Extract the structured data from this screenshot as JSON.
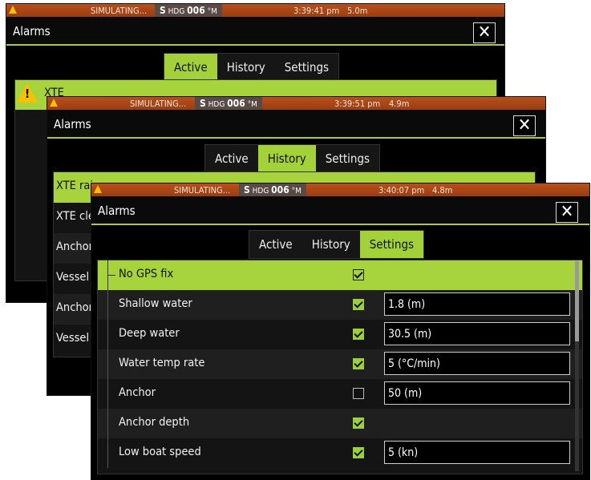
{
  "back_panel": {
    "status": {
      "sim": "SIMULATING...",
      "hdg_s": "S",
      "hdg_label": "HDG",
      "hdg_value": "006",
      "hdg_unit": "°M",
      "time": "3:39:41 pm",
      "depth": "5.0m"
    },
    "title": "Alarms",
    "close": "✕",
    "tabs": [
      {
        "label": "Active",
        "active": true
      },
      {
        "label": "History",
        "active": false
      },
      {
        "label": "Settings",
        "active": false
      }
    ],
    "active_alarm": "XTE"
  },
  "middle_panel": {
    "status": {
      "sim": "SIMULATING...",
      "hdg_s": "S",
      "hdg_label": "HDG",
      "hdg_value": "006",
      "hdg_unit": "°M",
      "time": "3:39:51 pm",
      "depth": "4.9m"
    },
    "title": "Alarms",
    "close": "✕",
    "tabs": [
      {
        "label": "Active",
        "active": false
      },
      {
        "label": "History",
        "active": true
      },
      {
        "label": "Settings",
        "active": false
      }
    ],
    "history": [
      "XTE rai",
      "XTE cle",
      "Anchor",
      "Vessel",
      "Anchor",
      "Vessel"
    ]
  },
  "front_panel": {
    "status": {
      "sim": "SIMULATING...",
      "hdg_s": "S",
      "hdg_label": "HDG",
      "hdg_value": "006",
      "hdg_unit": "°M",
      "time": "3:40:07 pm",
      "depth": "4.8m"
    },
    "title": "Alarms",
    "close": "✕",
    "tabs": [
      {
        "label": "Active",
        "active": false
      },
      {
        "label": "History",
        "active": false
      },
      {
        "label": "Settings",
        "active": true
      }
    ],
    "settings": [
      {
        "label": "No GPS fix",
        "checked": true,
        "value": null
      },
      {
        "label": "Shallow water",
        "checked": true,
        "value": "1.8 (m)"
      },
      {
        "label": "Deep water",
        "checked": true,
        "value": "30.5 (m)"
      },
      {
        "label": "Water temp rate",
        "checked": true,
        "value": "5 (°C/min)"
      },
      {
        "label": "Anchor",
        "checked": false,
        "value": "50 (m)"
      },
      {
        "label": "Anchor depth",
        "checked": true,
        "value": null
      },
      {
        "label": "Low boat speed",
        "checked": true,
        "value": "5 (kn)"
      }
    ]
  },
  "colors": {
    "accent": "#a3d13a",
    "statusbar": "#a8461a",
    "warning": "#f7c000"
  }
}
